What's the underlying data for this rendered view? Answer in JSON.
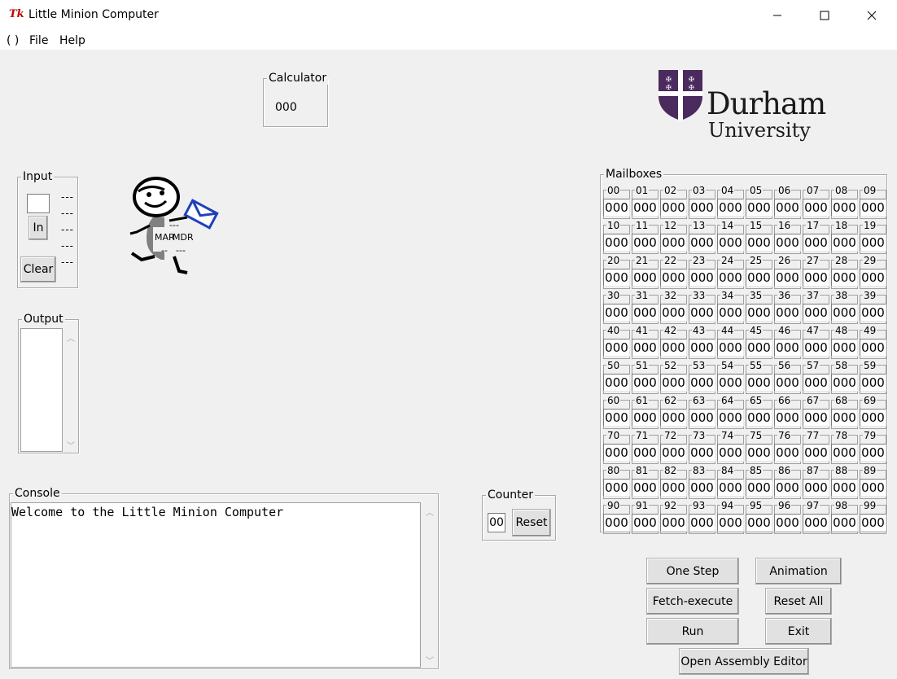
{
  "window": {
    "icon_text": "Tk",
    "title": "Little Minion Computer"
  },
  "menu": {
    "items": [
      "( )",
      "File",
      "Help"
    ]
  },
  "calculator": {
    "label": "Calculator",
    "value": "000"
  },
  "logo": {
    "line1": "Durham",
    "line2": "University",
    "brand_color": "#4b2a5e"
  },
  "input": {
    "label": "Input",
    "in_button": "In",
    "clear_button": "Clear",
    "queue": [
      "---",
      "---",
      "---",
      "---",
      "---"
    ]
  },
  "output": {
    "label": "Output"
  },
  "minion": {
    "mar_label": "MAR",
    "mdr_label": "MDR",
    "mar_value": "--",
    "mdr_value": "---",
    "bottom_values": [
      "--",
      "---"
    ]
  },
  "console": {
    "label": "Console",
    "text": "Welcome to the Little Minion Computer"
  },
  "counter": {
    "label": "Counter",
    "value": "00",
    "reset_button": "Reset"
  },
  "mailboxes": {
    "label": "Mailboxes",
    "numbers": [
      "00",
      "01",
      "02",
      "03",
      "04",
      "05",
      "06",
      "07",
      "08",
      "09",
      "10",
      "11",
      "12",
      "13",
      "14",
      "15",
      "16",
      "17",
      "18",
      "19",
      "20",
      "21",
      "22",
      "23",
      "24",
      "25",
      "26",
      "27",
      "28",
      "29",
      "30",
      "31",
      "32",
      "33",
      "34",
      "35",
      "36",
      "37",
      "38",
      "39",
      "40",
      "41",
      "42",
      "43",
      "44",
      "45",
      "46",
      "47",
      "48",
      "49",
      "50",
      "51",
      "52",
      "53",
      "54",
      "55",
      "56",
      "57",
      "58",
      "59",
      "60",
      "61",
      "62",
      "63",
      "64",
      "65",
      "66",
      "67",
      "68",
      "69",
      "70",
      "71",
      "72",
      "73",
      "74",
      "75",
      "76",
      "77",
      "78",
      "79",
      "80",
      "81",
      "82",
      "83",
      "84",
      "85",
      "86",
      "87",
      "88",
      "89",
      "90",
      "91",
      "92",
      "93",
      "94",
      "95",
      "96",
      "97",
      "98",
      "99"
    ],
    "values": [
      "000",
      "000",
      "000",
      "000",
      "000",
      "000",
      "000",
      "000",
      "000",
      "000",
      "000",
      "000",
      "000",
      "000",
      "000",
      "000",
      "000",
      "000",
      "000",
      "000",
      "000",
      "000",
      "000",
      "000",
      "000",
      "000",
      "000",
      "000",
      "000",
      "000",
      "000",
      "000",
      "000",
      "000",
      "000",
      "000",
      "000",
      "000",
      "000",
      "000",
      "000",
      "000",
      "000",
      "000",
      "000",
      "000",
      "000",
      "000",
      "000",
      "000",
      "000",
      "000",
      "000",
      "000",
      "000",
      "000",
      "000",
      "000",
      "000",
      "000",
      "000",
      "000",
      "000",
      "000",
      "000",
      "000",
      "000",
      "000",
      "000",
      "000",
      "000",
      "000",
      "000",
      "000",
      "000",
      "000",
      "000",
      "000",
      "000",
      "000",
      "000",
      "000",
      "000",
      "000",
      "000",
      "000",
      "000",
      "000",
      "000",
      "000",
      "000",
      "000",
      "000",
      "000",
      "000",
      "000",
      "000",
      "000",
      "000",
      "000"
    ]
  },
  "controls": {
    "one_step": "One Step",
    "animation": "Animation",
    "fetch_execute": "Fetch-execute",
    "reset_all": "Reset All",
    "run": "Run",
    "exit": "Exit",
    "open_editor": "Open Assembly Editor"
  }
}
